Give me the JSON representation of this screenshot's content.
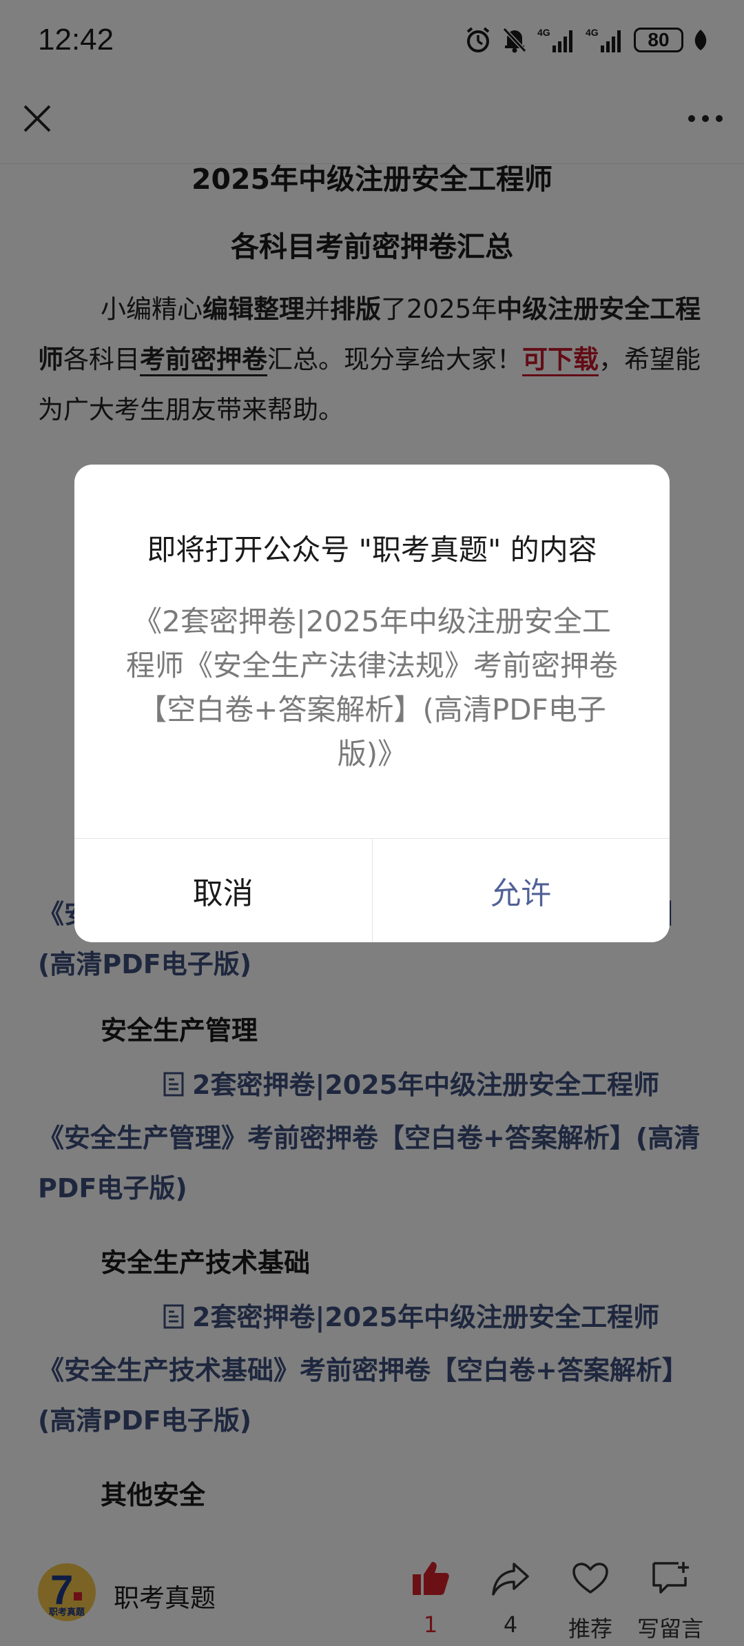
{
  "status_bar": {
    "time": "12:42",
    "icons": [
      "alarm-icon",
      "mute-bell-icon",
      "signal-4g-icon",
      "signal-4g-icon",
      "battery-icon",
      "leaf-icon"
    ],
    "network_label_1": "4G",
    "network_label_2": "4G",
    "battery": "80"
  },
  "nav": {
    "close_icon": "close-icon",
    "more_icon": "more-icon"
  },
  "article": {
    "title_line1": "2025年中级注册安全工程师",
    "title_line2": "各科目考前密押卷汇总",
    "intro": {
      "t1": "小编精心",
      "b1": "编辑整理",
      "t2": "并",
      "b2": "排版",
      "t3": "了2025年",
      "b3": "中级注册安全工程师",
      "t4": "各科目",
      "u1": "考前密押卷",
      "t5": "汇总。现分享给大家！",
      "link": "可下载",
      "t6": "，希望能为广大考生朋友带来帮助。"
    },
    "sections": [
      {
        "heading": "",
        "link": "2套密押卷|2025年中级注册安全工程师《安全生产法律法规》考前密押卷【空白卷+答案解析】(高清PDF电子版)"
      },
      {
        "heading": "安全生产管理",
        "link": "2套密押卷|2025年中级注册安全工程师《安全生产管理》考前密押卷【空白卷+答案解析】(高清PDF电子版)"
      },
      {
        "heading": "安全生产技术基础",
        "link": "2套密押卷|2025年中级注册安全工程师《安全生产技术基础》考前密押卷【空白卷+答案解析】(高清PDF电子版)"
      },
      {
        "heading": "其他安全",
        "link": ""
      }
    ]
  },
  "dialog": {
    "title": "即将打开公众号 \"职考真题\" 的内容",
    "body": "《2套密押卷|2025年中级注册安全工程师《安全生产法律法规》考前密押卷【空白卷+答案解析】(高清PDF电子版)》",
    "cancel": "取消",
    "allow": "允许"
  },
  "bottom_bar": {
    "account_name": "职考真题",
    "avatar_text": "职考真题",
    "like_count": "1",
    "share_count": "4",
    "recommend_label": "推荐",
    "comment_label": "写留言"
  },
  "colors": {
    "link_blue": "#3d4f7d",
    "allow_blue": "#506196",
    "accent_red": "#c4182b",
    "overlay": "rgba(0,0,0,0.5)"
  }
}
